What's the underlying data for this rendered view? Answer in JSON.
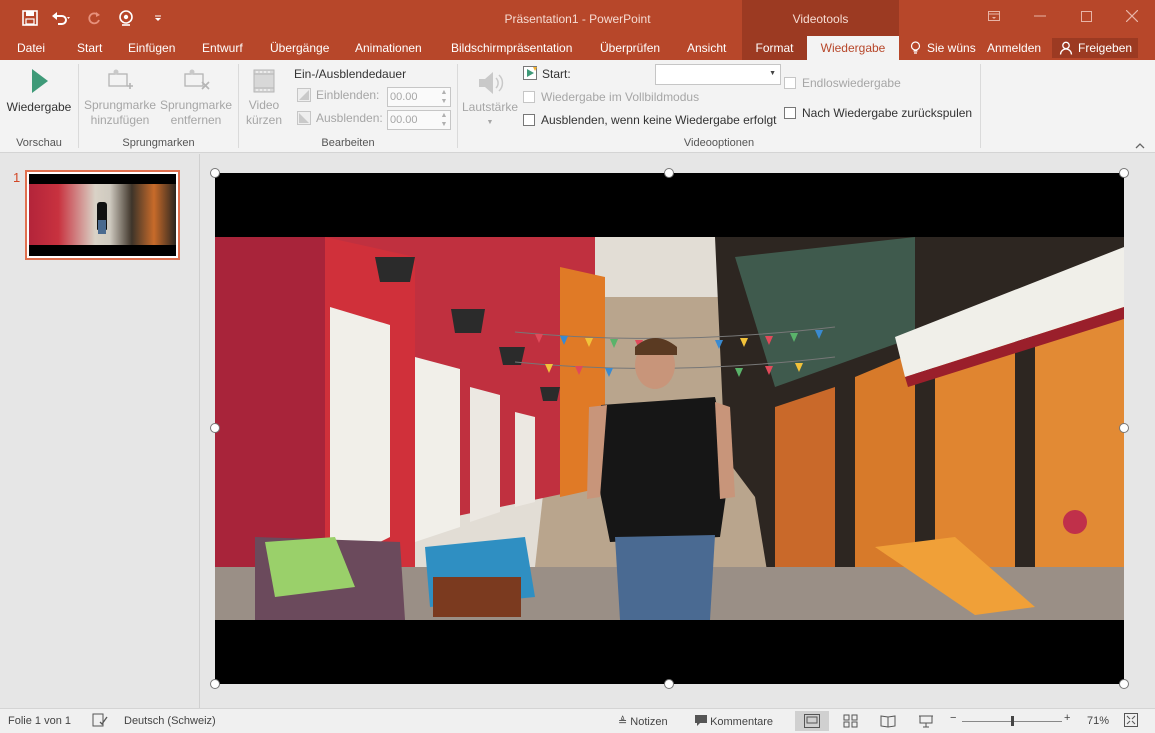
{
  "titlebar": {
    "doc_title": "Präsentation1 - PowerPoint",
    "contextual_title": "Videotools",
    "accent": "#b7472a"
  },
  "tabs": {
    "datei": "Datei",
    "start": "Start",
    "einfuegen": "Einfügen",
    "entwurf": "Entwurf",
    "uebergaenge": "Übergänge",
    "animationen": "Animationen",
    "bildschirm": "Bildschirmpräsentation",
    "ueberpruefen": "Überprüfen",
    "ansicht": "Ansicht",
    "format": "Format",
    "wiedergabe": "Wiedergabe",
    "tell_me": "Sie wüns",
    "anmelden": "Anmelden",
    "freigeben": "Freigeben"
  },
  "ribbon": {
    "vorschau": {
      "button": "Wiedergabe",
      "group": "Vorschau"
    },
    "sprungmarken": {
      "add_line1": "Sprungmarke",
      "add_line2": "hinzufügen",
      "remove_line1": "Sprungmarke",
      "remove_line2": "entfernen",
      "group": "Sprungmarken"
    },
    "bearbeiten": {
      "kuerzen_line1": "Video",
      "kuerzen_line2": "kürzen",
      "fade_title": "Ein-/Ausblendedauer",
      "einblenden_label": "Einblenden:",
      "einblenden_value": "00.00",
      "ausblenden_label": "Ausblenden:",
      "ausblenden_value": "00.00",
      "group": "Bearbeiten"
    },
    "videooptionen": {
      "lautstaerke": "Lautstärke",
      "start_label": "Start:",
      "start_value": "",
      "vollbild": "Wiedergabe im Vollbildmodus",
      "ausblenden": "Ausblenden, wenn keine Wiedergabe erfolgt",
      "endlos": "Endloswiedergabe",
      "zurueckspulen": "Nach Wiedergabe zurückspulen",
      "group": "Videooptionen"
    }
  },
  "thumbnails": [
    {
      "number": "1"
    }
  ],
  "statusbar": {
    "folie": "Folie 1 von 1",
    "sprache": "Deutsch (Schweiz)",
    "notizen": "Notizen",
    "kommentare": "Kommentare",
    "zoom": "71%",
    "zoom_level": 0.5
  }
}
